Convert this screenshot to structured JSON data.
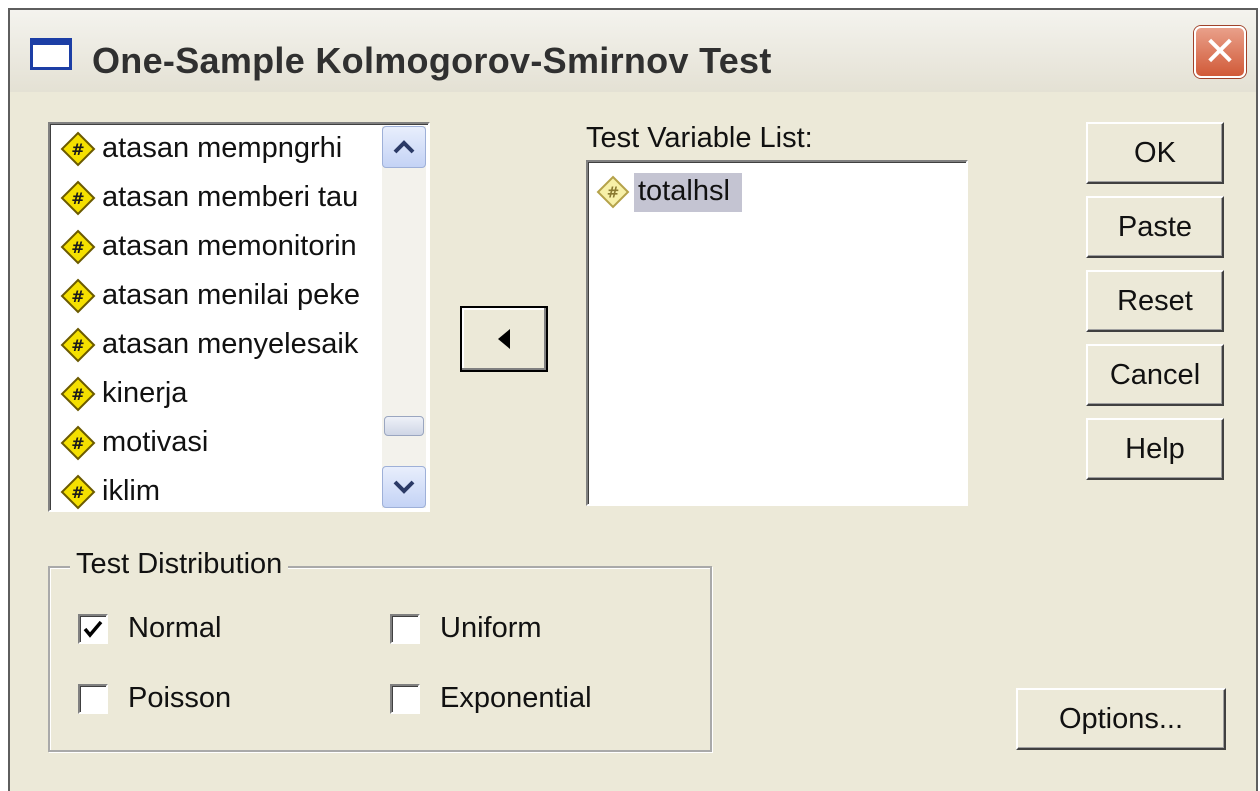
{
  "window": {
    "title": "One-Sample Kolmogorov-Smirnov Test",
    "close_label": "✕"
  },
  "variables": {
    "items": [
      {
        "label": "atasan mempngrhi"
      },
      {
        "label": "atasan memberi tau"
      },
      {
        "label": "atasan memonitorin"
      },
      {
        "label": "atasan menilai peke"
      },
      {
        "label": "atasan menyelesaik"
      },
      {
        "label": "kinerja"
      },
      {
        "label": "motivasi"
      },
      {
        "label": "iklim"
      }
    ]
  },
  "test_variable_list": {
    "label": "Test Variable List:",
    "items": [
      {
        "label": "totalhsl",
        "selected": true
      }
    ]
  },
  "buttons": {
    "ok": "OK",
    "paste": "Paste",
    "reset": "Reset",
    "cancel": "Cancel",
    "help": "Help",
    "options": "Options..."
  },
  "test_distribution": {
    "label": "Test Distribution",
    "normal": {
      "label": "Normal",
      "checked": true
    },
    "uniform": {
      "label": "Uniform",
      "checked": false
    },
    "poisson": {
      "label": "Poisson",
      "checked": false
    },
    "exponential": {
      "label": "Exponential",
      "checked": false
    }
  },
  "icons": {
    "variable": "numeric-variable-icon",
    "move": "arrow-left-icon",
    "scroll_up": "chevron-up-icon",
    "scroll_down": "chevron-down-icon",
    "check": "check-icon"
  },
  "colors": {
    "dialog_bg": "#ece9d8",
    "title_close": "#d15a38",
    "selection": "#c4c4d2",
    "variable_icon": "#f5e000"
  }
}
